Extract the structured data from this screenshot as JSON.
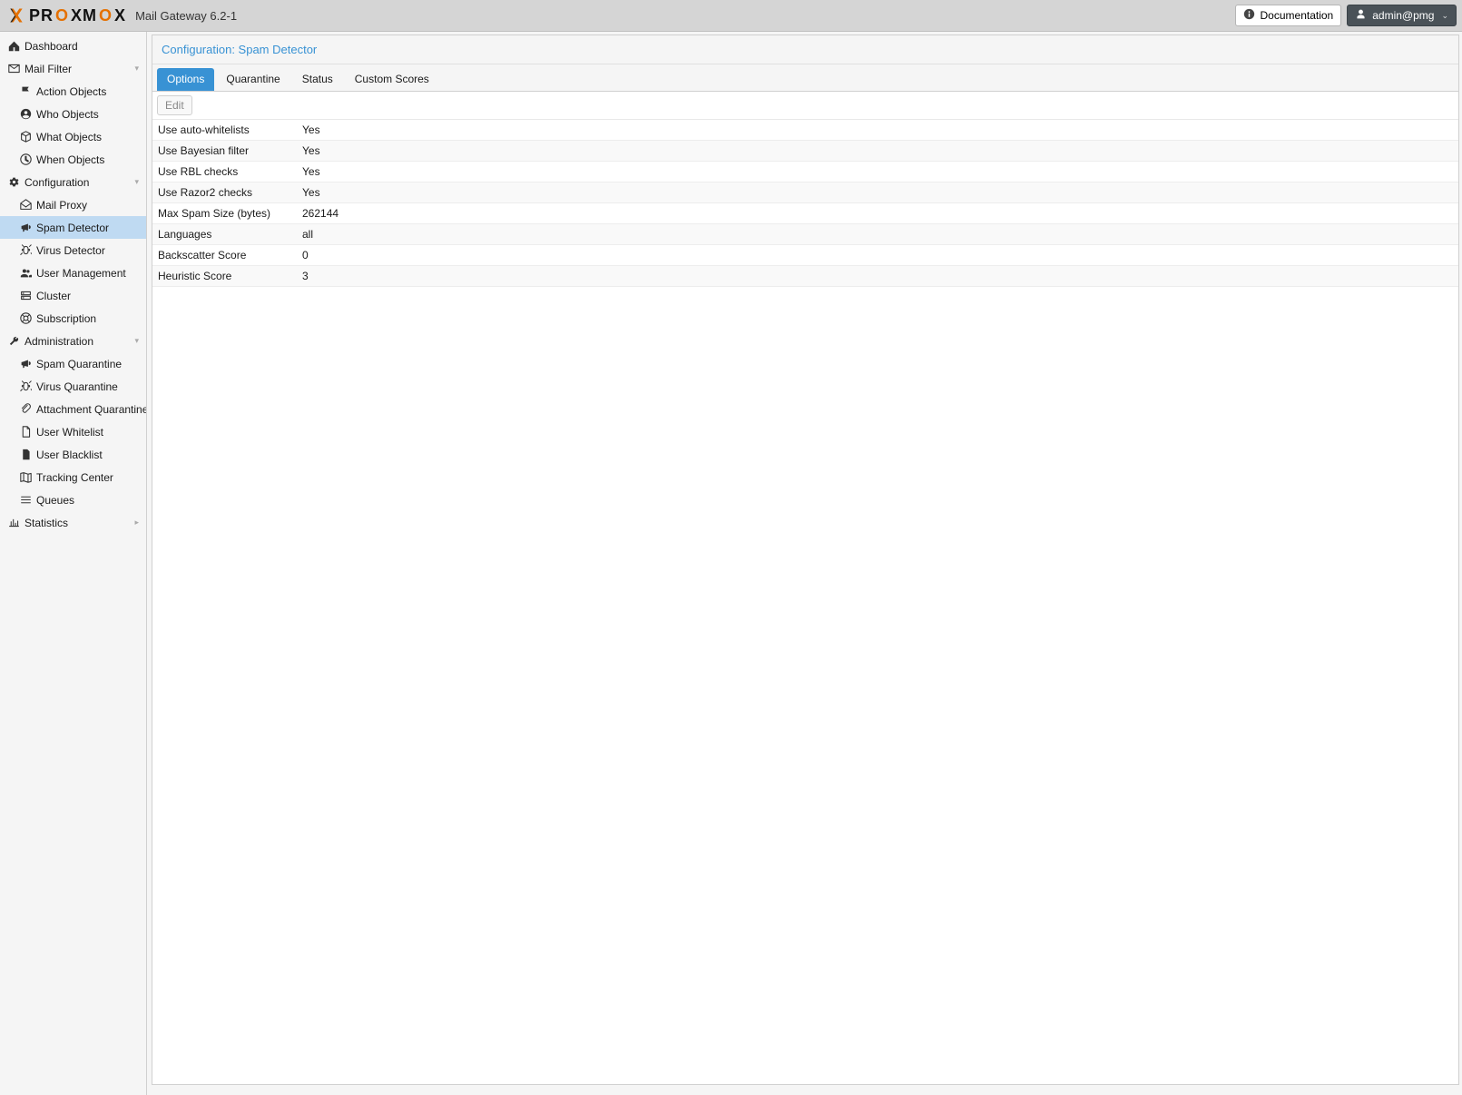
{
  "header": {
    "logo_main": "PR",
    "logo_o1": "O",
    "logo_mid": "XM",
    "logo_o2": "O",
    "logo_end": "X",
    "product": "Mail Gateway 6.2-1",
    "doc_btn": "Documentation",
    "user_btn": "admin@pmg"
  },
  "sidebar": [
    {
      "label": "Dashboard",
      "icon": "dashboard",
      "child": false
    },
    {
      "label": "Mail Filter",
      "icon": "mail",
      "child": false,
      "expandable": true
    },
    {
      "label": "Action Objects",
      "icon": "flag",
      "child": true
    },
    {
      "label": "Who Objects",
      "icon": "user-circle",
      "child": true
    },
    {
      "label": "What Objects",
      "icon": "cube",
      "child": true
    },
    {
      "label": "When Objects",
      "icon": "clock",
      "child": true
    },
    {
      "label": "Configuration",
      "icon": "cogs",
      "child": false,
      "expandable": true
    },
    {
      "label": "Mail Proxy",
      "icon": "envelope-open",
      "child": true
    },
    {
      "label": "Spam Detector",
      "icon": "bullhorn",
      "child": true,
      "selected": true
    },
    {
      "label": "Virus Detector",
      "icon": "bug",
      "child": true
    },
    {
      "label": "User Management",
      "icon": "users",
      "child": true
    },
    {
      "label": "Cluster",
      "icon": "server",
      "child": true
    },
    {
      "label": "Subscription",
      "icon": "life-ring",
      "child": true
    },
    {
      "label": "Administration",
      "icon": "wrench",
      "child": false,
      "expandable": true
    },
    {
      "label": "Spam Quarantine",
      "icon": "bullhorn",
      "child": true
    },
    {
      "label": "Virus Quarantine",
      "icon": "bug",
      "child": true
    },
    {
      "label": "Attachment Quarantine",
      "icon": "paperclip",
      "child": true
    },
    {
      "label": "User Whitelist",
      "icon": "file",
      "child": true
    },
    {
      "label": "User Blacklist",
      "icon": "file-solid",
      "child": true
    },
    {
      "label": "Tracking Center",
      "icon": "map",
      "child": true
    },
    {
      "label": "Queues",
      "icon": "bars",
      "child": true
    },
    {
      "label": "Statistics",
      "icon": "chart",
      "child": false,
      "expandRight": true
    }
  ],
  "main": {
    "title": "Configuration: Spam Detector",
    "tabs": [
      "Options",
      "Quarantine",
      "Status",
      "Custom Scores"
    ],
    "active_tab": 0,
    "edit_btn": "Edit",
    "options": [
      {
        "label": "Use auto-whitelists",
        "value": "Yes"
      },
      {
        "label": "Use Bayesian filter",
        "value": "Yes"
      },
      {
        "label": "Use RBL checks",
        "value": "Yes"
      },
      {
        "label": "Use Razor2 checks",
        "value": "Yes"
      },
      {
        "label": "Max Spam Size (bytes)",
        "value": "262144"
      },
      {
        "label": "Languages",
        "value": "all"
      },
      {
        "label": "Backscatter Score",
        "value": "0"
      },
      {
        "label": "Heuristic Score",
        "value": "3"
      }
    ]
  }
}
